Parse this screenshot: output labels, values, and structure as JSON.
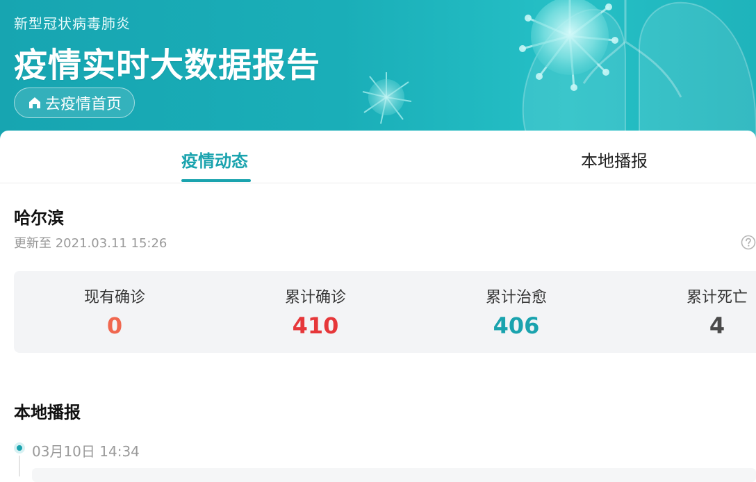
{
  "header": {
    "subtitle": "新型冠状病毒肺炎",
    "title": "疫情实时大数据报告",
    "home_button": "去疫情首页",
    "home_icon": "home-icon",
    "accent": "#17a5b1"
  },
  "tabs": [
    {
      "label": "疫情动态",
      "active": true
    },
    {
      "label": "本地播报",
      "active": false
    }
  ],
  "location": {
    "city": "哈尔滨",
    "updated": "更新至 2021.03.11 15:26",
    "help_icon": "help-circle-icon"
  },
  "stats": [
    {
      "label": "现有确诊",
      "value": "0",
      "color": "#f0674f"
    },
    {
      "label": "累计确诊",
      "value": "410",
      "color": "#e6373a"
    },
    {
      "label": "累计治愈",
      "value": "406",
      "color": "#1aa3ae"
    },
    {
      "label": "累计死亡",
      "value": "4",
      "color": "#4a4a4a"
    }
  ],
  "local_news": {
    "title": "本地播报",
    "items": [
      {
        "date": "03月10日  14:34"
      }
    ]
  }
}
